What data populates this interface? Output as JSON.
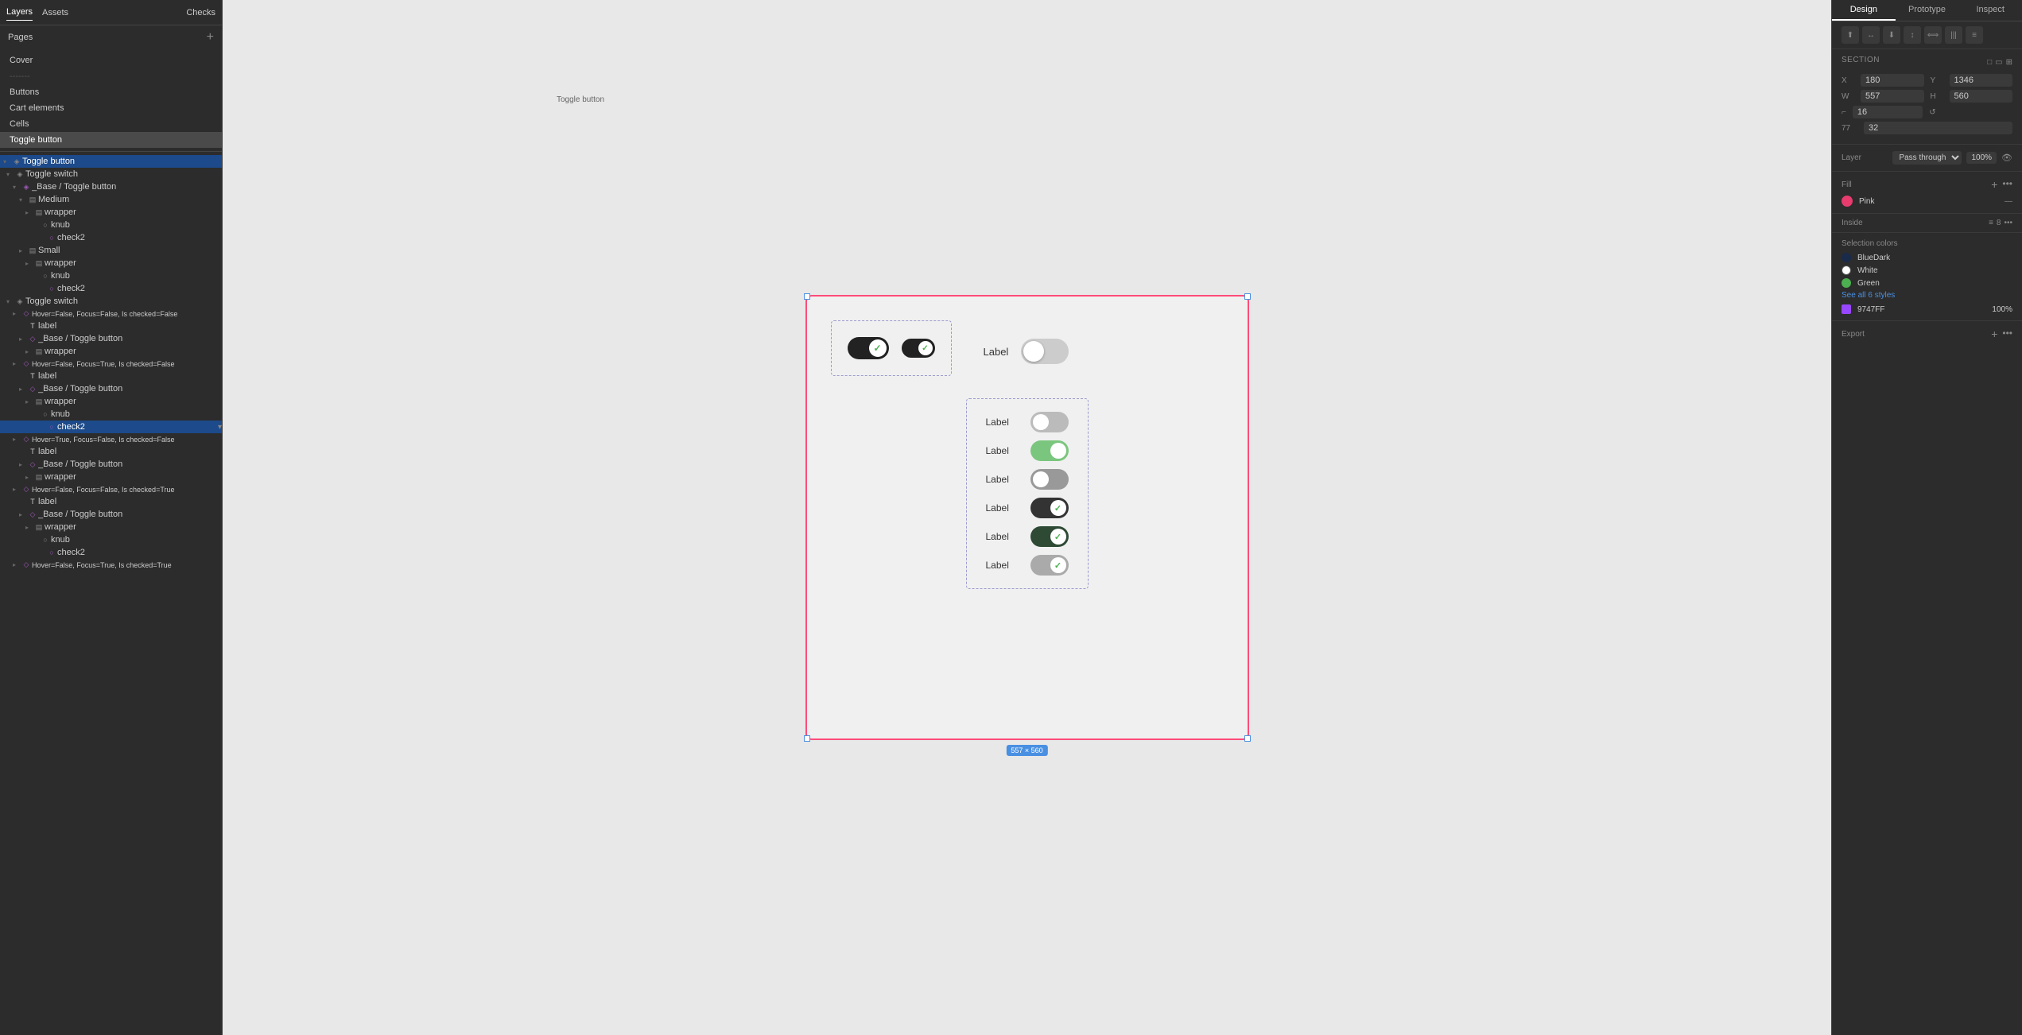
{
  "left_panel": {
    "tabs": [
      "Layers",
      "Assets"
    ],
    "active_tab": "Layers",
    "checks_tab": "Checks",
    "pages_header": "Pages",
    "pages": [
      {
        "label": "Cover",
        "active": false
      },
      {
        "label": "-------",
        "active": false
      },
      {
        "label": "Buttons",
        "active": false
      },
      {
        "label": "Cart elements",
        "active": false
      },
      {
        "label": "Cells",
        "active": false
      },
      {
        "label": "Toggle button",
        "active": true
      }
    ],
    "tree": [
      {
        "indent": 0,
        "icon": "◈",
        "label": "Toggle switch",
        "expanded": true,
        "type": "frame"
      },
      {
        "indent": 1,
        "icon": "◈",
        "label": "_Base / Toggle button",
        "expanded": true,
        "type": "component"
      },
      {
        "indent": 2,
        "icon": "▤",
        "label": "Medium",
        "expanded": true,
        "type": "group"
      },
      {
        "indent": 3,
        "icon": "▤",
        "label": "wrapper",
        "expanded": false,
        "type": "frame"
      },
      {
        "indent": 4,
        "icon": "○",
        "label": "knub",
        "expanded": false,
        "type": "ellipse"
      },
      {
        "indent": 5,
        "icon": "○",
        "label": "check2",
        "expanded": false,
        "type": "ellipse"
      },
      {
        "indent": 2,
        "icon": "▤",
        "label": "Small",
        "expanded": false,
        "type": "group"
      },
      {
        "indent": 3,
        "icon": "▤",
        "label": "wrapper",
        "expanded": false,
        "type": "frame"
      },
      {
        "indent": 4,
        "icon": "○",
        "label": "knub",
        "expanded": false,
        "type": "ellipse"
      },
      {
        "indent": 5,
        "icon": "○",
        "label": "check2",
        "expanded": false,
        "type": "ellipse"
      },
      {
        "indent": 0,
        "icon": "◈",
        "label": "Toggle switch",
        "expanded": true,
        "type": "frame"
      },
      {
        "indent": 1,
        "icon": "◇",
        "label": "Hover=False, Focus=False, Is checked=False",
        "expanded": false,
        "type": "variant"
      },
      {
        "indent": 2,
        "icon": "T",
        "label": "label",
        "expanded": false,
        "type": "text"
      },
      {
        "indent": 2,
        "icon": "◇",
        "label": "_Base / Toggle button",
        "expanded": false,
        "type": "component"
      },
      {
        "indent": 3,
        "icon": "▤",
        "label": "wrapper",
        "expanded": false,
        "type": "frame"
      },
      {
        "indent": 1,
        "icon": "◇",
        "label": "Hover=False, Focus=True, Is checked=False",
        "expanded": false,
        "type": "variant"
      },
      {
        "indent": 2,
        "icon": "T",
        "label": "label",
        "expanded": false,
        "type": "text"
      },
      {
        "indent": 2,
        "icon": "◇",
        "label": "_Base / Toggle button",
        "expanded": false,
        "type": "component"
      },
      {
        "indent": 3,
        "icon": "▤",
        "label": "wrapper",
        "expanded": false,
        "type": "frame"
      },
      {
        "indent": 4,
        "icon": "○",
        "label": "knub",
        "expanded": false,
        "type": "ellipse"
      },
      {
        "indent": 5,
        "icon": "○",
        "label": "check2",
        "expanded": false,
        "type": "ellipse",
        "selected": true
      },
      {
        "indent": 1,
        "icon": "◇",
        "label": "Hover=True, Focus=False, Is checked=False",
        "expanded": false,
        "type": "variant"
      },
      {
        "indent": 2,
        "icon": "T",
        "label": "label",
        "expanded": false,
        "type": "text"
      },
      {
        "indent": 2,
        "icon": "◇",
        "label": "_Base / Toggle button",
        "expanded": false,
        "type": "component"
      },
      {
        "indent": 3,
        "icon": "▤",
        "label": "wrapper",
        "expanded": false,
        "type": "frame"
      },
      {
        "indent": 1,
        "icon": "◇",
        "label": "Hover=False, Focus=False, Is checked=True",
        "expanded": false,
        "type": "variant"
      },
      {
        "indent": 2,
        "icon": "T",
        "label": "label",
        "expanded": false,
        "type": "text"
      },
      {
        "indent": 2,
        "icon": "◇",
        "label": "_Base / Toggle button",
        "expanded": false,
        "type": "component"
      },
      {
        "indent": 3,
        "icon": "▤",
        "label": "wrapper",
        "expanded": false,
        "type": "frame"
      },
      {
        "indent": 4,
        "icon": "○",
        "label": "knub",
        "expanded": false,
        "type": "ellipse"
      },
      {
        "indent": 5,
        "icon": "○",
        "label": "check2",
        "expanded": false,
        "type": "ellipse"
      },
      {
        "indent": 1,
        "icon": "◇",
        "label": "Hover=False, Focus=True, Is checked=True",
        "expanded": false,
        "type": "variant"
      }
    ]
  },
  "canvas": {
    "section_label": "Toggle button",
    "size_badge": "557 × 560"
  },
  "toggle_buttons": [
    {
      "id": "tb1",
      "checked": true,
      "size": "large"
    },
    {
      "id": "tb2",
      "checked": true,
      "size": "small"
    }
  ],
  "toggle_switches": [
    {
      "label": "Label",
      "state": "off",
      "checked": false
    },
    {
      "label": "Label",
      "state": "on-green",
      "checked": false
    },
    {
      "label": "Label",
      "state": "off-focus",
      "checked": false
    },
    {
      "label": "Label",
      "state": "on-dark",
      "checked": true
    },
    {
      "label": "Label",
      "state": "on-darkgreen",
      "checked": true
    },
    {
      "label": "Label",
      "state": "off-checked",
      "checked": true
    }
  ],
  "large_toggle": {
    "label": "Label",
    "state": "off"
  },
  "right_panel": {
    "tabs": [
      "Design",
      "Prototype",
      "Inspect"
    ],
    "active_tab": "Design",
    "section": {
      "title": "Section",
      "x": "180",
      "y": "1346",
      "w": "557",
      "h": "560",
      "corner_r": "16",
      "angle": "77",
      "angle2": "32"
    },
    "layer": {
      "blend_mode": "Pass through",
      "opacity": "100%",
      "eye_visible": true
    },
    "fill": {
      "title": "Fill",
      "items": [
        {
          "color": "#e83b6e",
          "name": "Pink",
          "style": "—"
        }
      ]
    },
    "inside": {
      "label": "Inside",
      "icon1": "≡",
      "icon2": "8"
    },
    "selection_colors": {
      "title": "Selection colors",
      "colors": [
        {
          "name": "BlueDark",
          "color": "#1a2a4a"
        },
        {
          "name": "White",
          "color": "#ffffff"
        },
        {
          "name": "Green",
          "color": "#4caf50"
        }
      ],
      "see_all": "See all 6 styles",
      "hex": "9747FF",
      "hex_opacity": "100%"
    },
    "export": {
      "title": "Export"
    }
  }
}
